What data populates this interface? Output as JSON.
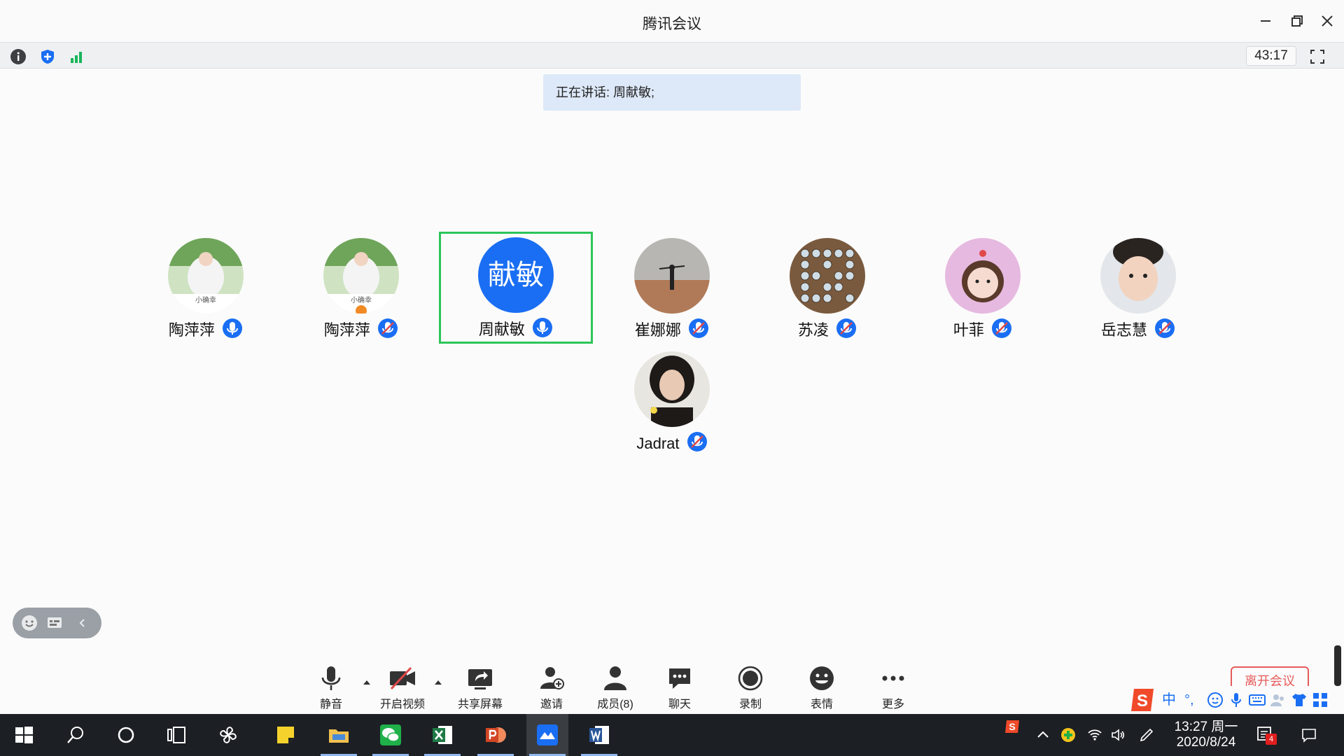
{
  "window": {
    "title": "腾讯会议"
  },
  "infobar": {
    "timer": "43:17"
  },
  "speaking": {
    "text": "正在讲话: 周献敏;"
  },
  "participants": [
    {
      "name": "陶萍萍",
      "mic": "on",
      "avatar_caption": "小确幸"
    },
    {
      "name": "陶萍萍",
      "mic": "muted",
      "avatar_caption": "小确幸"
    },
    {
      "name": "周献敏",
      "mic": "on",
      "avatar_text": "献敏",
      "speaking": true
    },
    {
      "name": "崔娜娜",
      "mic": "muted"
    },
    {
      "name": "苏凌",
      "mic": "muted"
    },
    {
      "name": "叶菲",
      "mic": "muted"
    },
    {
      "name": "岳志慧",
      "mic": "muted"
    },
    {
      "name": "Jadrat",
      "mic": "muted"
    }
  ],
  "toolbar": {
    "mute": "静音",
    "video": "开启视频",
    "share": "共享屏幕",
    "invite": "邀请",
    "members": "成员(8)",
    "chat": "聊天",
    "record": "录制",
    "emoji": "表情",
    "more": "更多",
    "leave": "离开会议"
  },
  "ime": {
    "lang": "中",
    "punct": "°,"
  },
  "taskbar": {
    "time": "13:27 周一",
    "date": "2020/8/24",
    "notification_count": "4"
  },
  "colors": {
    "accent": "#1a6ef3",
    "speaking_border": "#2dc55a",
    "leave": "#e65a5a",
    "banner_bg": "#dde8f8"
  }
}
